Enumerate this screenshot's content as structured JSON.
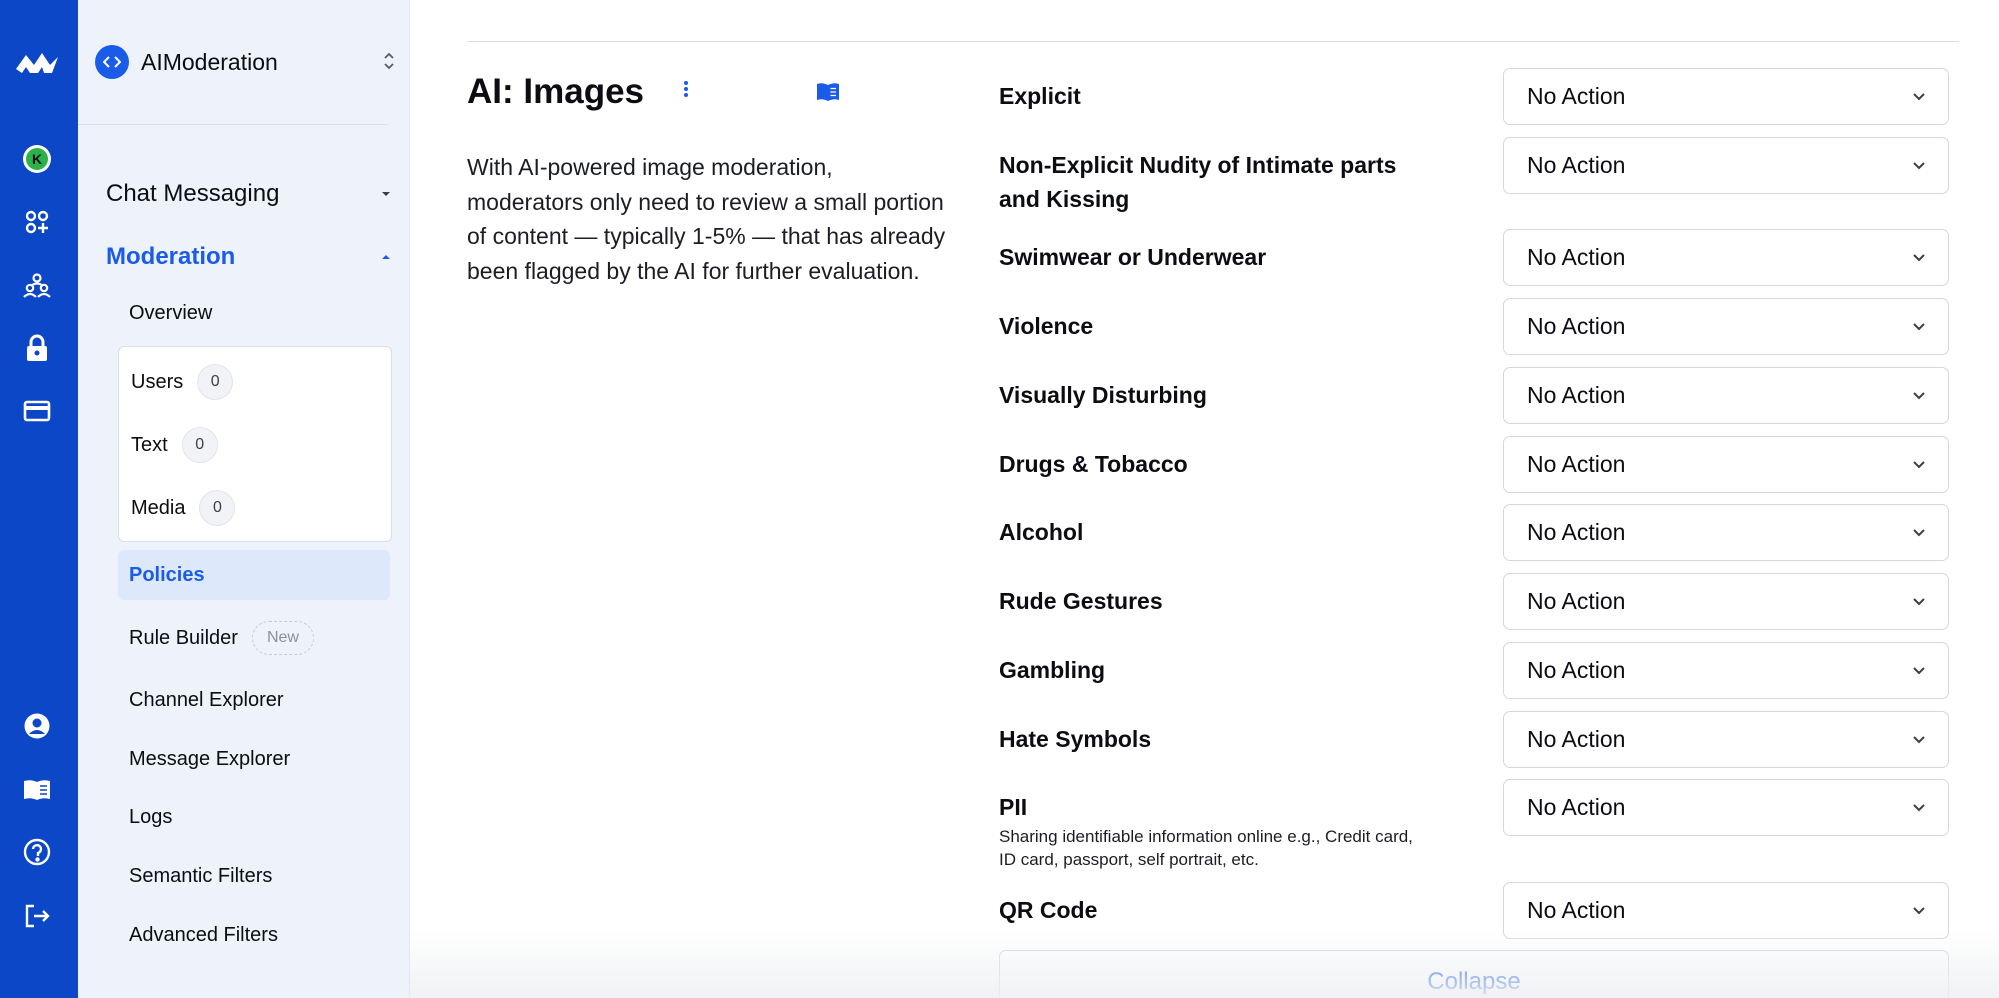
{
  "app": {
    "name": "AIModeration"
  },
  "sidebar": {
    "sections": [
      {
        "label": "Chat Messaging"
      },
      {
        "label": "Moderation"
      }
    ],
    "overview_label": "Overview",
    "queues": [
      {
        "label": "Users",
        "count": "0"
      },
      {
        "label": "Text",
        "count": "0"
      },
      {
        "label": "Media",
        "count": "0"
      }
    ],
    "items": [
      {
        "label": "Policies"
      },
      {
        "label": "Rule Builder",
        "badge": "New"
      },
      {
        "label": "Channel Explorer"
      },
      {
        "label": "Message Explorer"
      },
      {
        "label": "Logs"
      },
      {
        "label": "Semantic Filters"
      },
      {
        "label": "Advanced Filters"
      }
    ]
  },
  "rail": {
    "avatar_letter": "K",
    "avatar_color": "#2bb34a",
    "accent": "#0b47c7",
    "icons": [
      "logo-icon",
      "avatar-icon",
      "apps-icon",
      "users-icon",
      "lock-icon",
      "billing-icon",
      "account-icon",
      "docs-icon",
      "help-icon",
      "logout-icon"
    ]
  },
  "main": {
    "title": "AI: Images",
    "description": "With AI-powered image moderation, moderators only need to review a small portion of content — typically 1-5% — that has already been flagged by the AI for further evaluation.",
    "rows": [
      {
        "label": "Explicit",
        "value": "No Action"
      },
      {
        "label": "Non-Explicit Nudity of Intimate parts and Kissing",
        "value": "No Action"
      },
      {
        "label": "Swimwear or Underwear",
        "value": "No Action"
      },
      {
        "label": "Violence",
        "value": "No Action"
      },
      {
        "label": "Visually Disturbing",
        "value": "No Action"
      },
      {
        "label": "Drugs & Tobacco",
        "value": "No Action"
      },
      {
        "label": "Alcohol",
        "value": "No Action"
      },
      {
        "label": "Rude Gestures",
        "value": "No Action"
      },
      {
        "label": "Gambling",
        "value": "No Action"
      },
      {
        "label": "Hate Symbols",
        "value": "No Action"
      },
      {
        "label": "PII",
        "sublabel": "Sharing identifiable information online e.g., Credit card, ID card, passport, self portrait, etc.",
        "value": "No Action"
      },
      {
        "label": "QR Code",
        "value": "No Action"
      }
    ],
    "collapse_label": "Collapse"
  }
}
